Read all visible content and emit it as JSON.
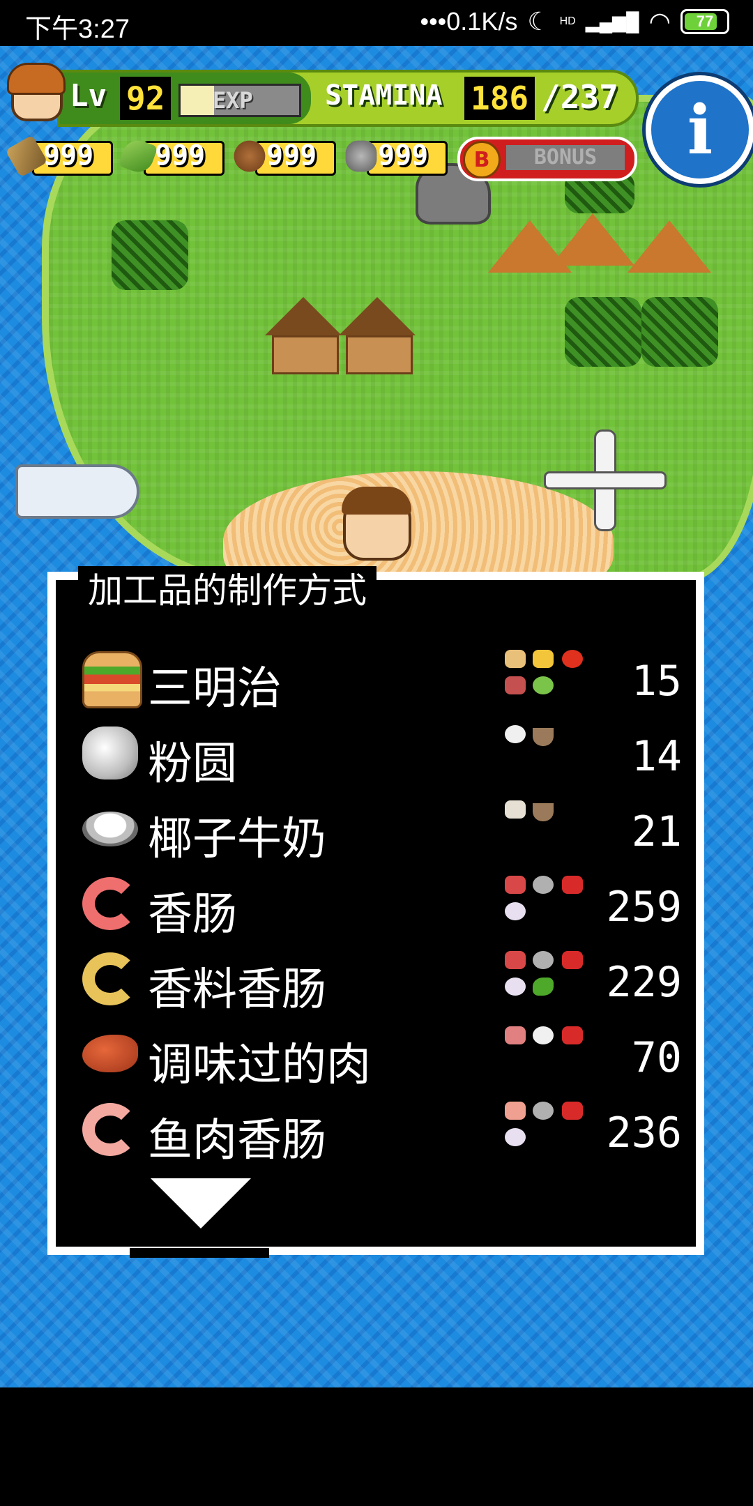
{
  "status_bar": {
    "time": "下午3:27",
    "network_speed": "•••0.1K/s",
    "moon_icon": "☾",
    "hd_label": "HD",
    "signal_icon": "▂▄▆█",
    "wifi_icon": "◠",
    "battery": "77"
  },
  "hud": {
    "level_label": "Lv",
    "level_value": "92",
    "exp_label": "EXP",
    "exp_fill_fraction": 0.28,
    "stamina_label": "STAMINA",
    "stamina_current": "186",
    "stamina_max": "/237",
    "info_symbol": "i",
    "resources": [
      {
        "icon": "wood-icon",
        "value": "999"
      },
      {
        "icon": "grass-icon",
        "value": "999"
      },
      {
        "icon": "nut-icon",
        "value": "999"
      },
      {
        "icon": "stone-icon",
        "value": "999"
      }
    ],
    "bonus_coin": "B",
    "bonus_label": "BONUS"
  },
  "panel": {
    "title": "加工品的制作方式",
    "recipes": [
      {
        "name": "三明治",
        "count": "15",
        "icon": "sandwich-icon"
      },
      {
        "name": "粉圆",
        "count": "14",
        "icon": "tapioca-icon"
      },
      {
        "name": "椰子牛奶",
        "count": "21",
        "icon": "coconut-milk-icon"
      },
      {
        "name": "香肠",
        "count": "259",
        "icon": "sausage-icon"
      },
      {
        "name": "香料香肠",
        "count": "229",
        "icon": "spice-sausage-icon"
      },
      {
        "name": "调味过的肉",
        "count": "70",
        "icon": "seasoned-meat-icon"
      },
      {
        "name": "鱼肉香肠",
        "count": "236",
        "icon": "fish-sausage-icon"
      }
    ]
  },
  "colors": {
    "ocean": "#1d8be0",
    "grass": "#72c23a",
    "panel_bg": "#000000",
    "panel_border": "#ffffff",
    "accent_yellow": "#ffd83a",
    "bonus_red": "#d01e1e"
  }
}
